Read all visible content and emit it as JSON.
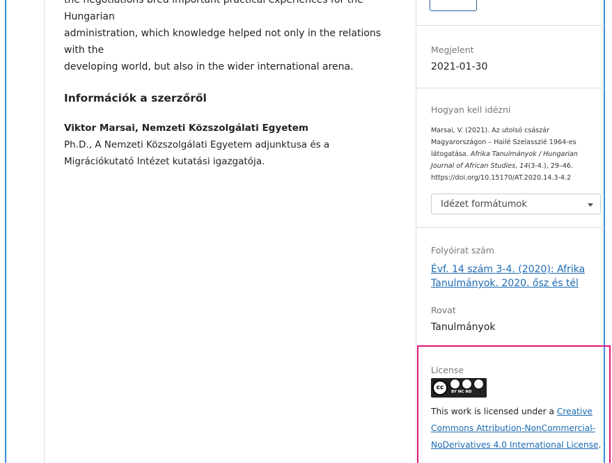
{
  "abstract": {
    "line_cut": "the negotiations bred important practical experiences for the Hungarian",
    "line_2": "administration, which knowledge helped not only in the relations with the",
    "line_3": "developing world, but also in the wider international arena."
  },
  "author_section": {
    "title": "Információk a szerzőről",
    "name": "Viktor Marsai, Nemzeti Közszolgálati Egyetem",
    "bio": "Ph.D., A Nemzeti Közszolgálati Egyetem adjunktusa és a Migrációkutató Intézet kutatási igazgatója."
  },
  "sidebar": {
    "published": {
      "label": "Megjelent",
      "value": "2021-01-30"
    },
    "citation": {
      "label": "Hogyan kell idézni",
      "text_part1": "Marsai, V. (2021). Az utolsó császár Magyarországon – Hailé Szelasszié 1964-es látogatása. ",
      "journal": "Afrika Tanulmányok / Hungarian Journal of African Studies",
      "text_part2": ", ",
      "volume": "14",
      "text_part3": "(3-4.), 29–46.",
      "doi": "https://doi.org/10.15170/AT.2020.14.3-4.2",
      "formats_placeholder": "Idézet formátumok"
    },
    "issue": {
      "label": "Folyóirat szám",
      "link": "Évf. 14 szám 3-4. (2020): Afrika Tanulmányok. 2020. ősz és tél"
    },
    "section": {
      "label": "Rovat",
      "value": "Tanulmányok"
    },
    "license": {
      "label": "License",
      "badge_icon": "cc-by-nc-nd-icon",
      "badge_text": "BY NC ND",
      "text_before": "This work is licensed under a ",
      "link": "Creative Commons Attribution-NonCommercial-NoDerivatives 4.0 International License",
      "text_after": "."
    }
  },
  "colors": {
    "frame": "#3b8ee0",
    "link": "#1b6ab2",
    "highlight": "#e0147a"
  }
}
